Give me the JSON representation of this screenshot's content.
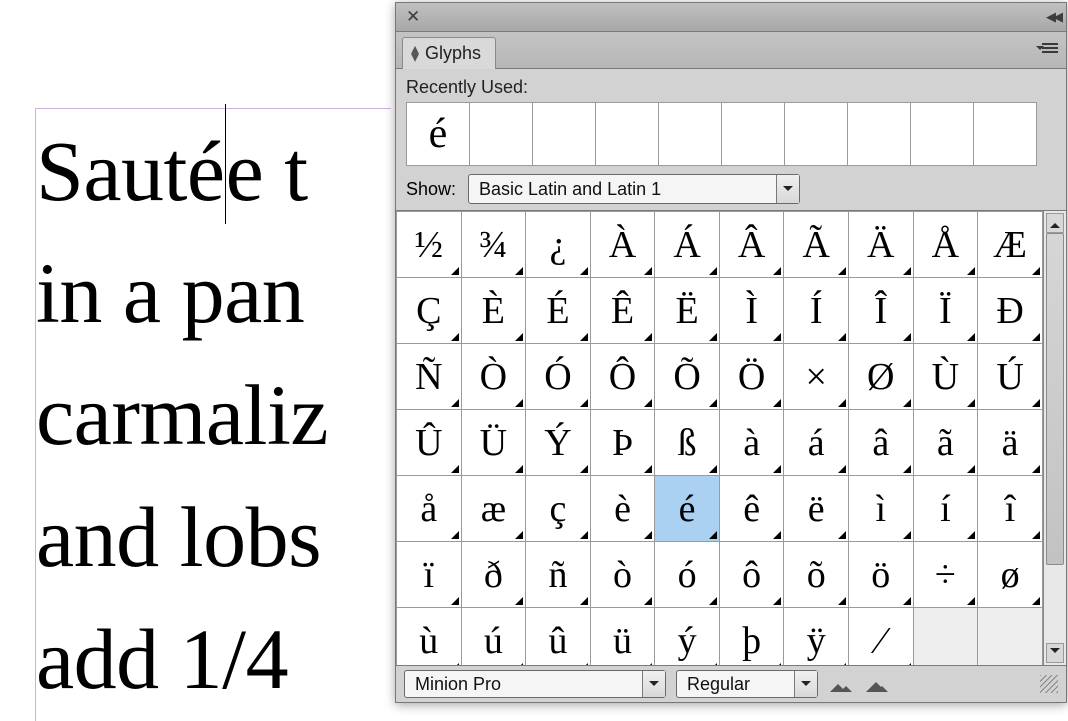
{
  "document": {
    "line1_a": "Sauté",
    "line1_b": "e t",
    "line2": "in a pan",
    "line3": "carmaliz",
    "line4": "and lobs",
    "line5": "add 1/4"
  },
  "panel": {
    "title": "Glyphs",
    "recent_label": "Recently Used:",
    "recent": [
      "é",
      "",
      "",
      "",
      "",
      "",
      "",
      "",
      "",
      ""
    ],
    "show_label": "Show:",
    "show_value": "Basic Latin and Latin 1",
    "font": "Minion Pro",
    "style": "Regular",
    "selected_glyph": "é",
    "grid": [
      [
        "½",
        "¾",
        "¿",
        "À",
        "Á",
        "Â",
        "Ã",
        "Ä",
        "Å",
        "Æ"
      ],
      [
        "Ç",
        "È",
        "É",
        "Ê",
        "Ë",
        "Ì",
        "Í",
        "Î",
        "Ï",
        "Ð"
      ],
      [
        "Ñ",
        "Ò",
        "Ó",
        "Ô",
        "Õ",
        "Ö",
        "×",
        "Ø",
        "Ù",
        "Ú"
      ],
      [
        "Û",
        "Ü",
        "Ý",
        "Þ",
        "ß",
        "à",
        "á",
        "â",
        "ã",
        "ä"
      ],
      [
        "å",
        "æ",
        "ç",
        "è",
        "é",
        "ê",
        "ë",
        "ì",
        "í",
        "î"
      ],
      [
        "ï",
        "ð",
        "ñ",
        "ò",
        "ó",
        "ô",
        "õ",
        "ö",
        "÷",
        "ø"
      ],
      [
        "ù",
        "ú",
        "û",
        "ü",
        "ý",
        "þ",
        "ÿ",
        "⁄",
        "",
        ""
      ]
    ]
  }
}
